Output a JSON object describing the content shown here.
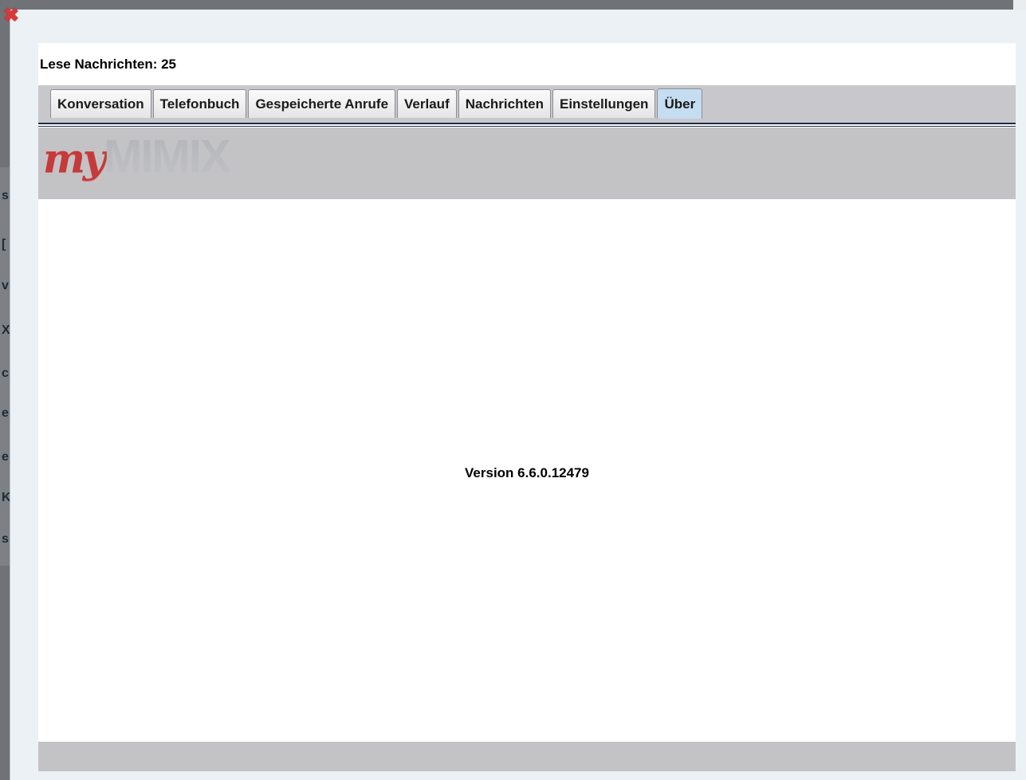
{
  "dialog": {
    "close_icon": "close-icon",
    "read_messages": "Lese Nachrichten: 25"
  },
  "tabs": [
    {
      "label": "Konversation",
      "active": false
    },
    {
      "label": "Telefonbuch",
      "active": false
    },
    {
      "label": "Gespeicherte Anrufe",
      "active": false
    },
    {
      "label": "Verlauf",
      "active": false
    },
    {
      "label": "Nachrichten",
      "active": false
    },
    {
      "label": "Einstellungen",
      "active": false
    },
    {
      "label": "Über",
      "active": true
    }
  ],
  "logo": {
    "my": "my",
    "brand": "MIMIX"
  },
  "about": {
    "version": "Version 6.6.0.12479"
  },
  "background": {
    "left_fragments": [
      "s",
      "[",
      "v",
      "X",
      "c",
      "e",
      "e:",
      "K",
      "s"
    ]
  },
  "colors": {
    "tab_active": "#c4ddf0",
    "logo_red": "#c53a3a",
    "band_gray": "#c3c3c6"
  }
}
